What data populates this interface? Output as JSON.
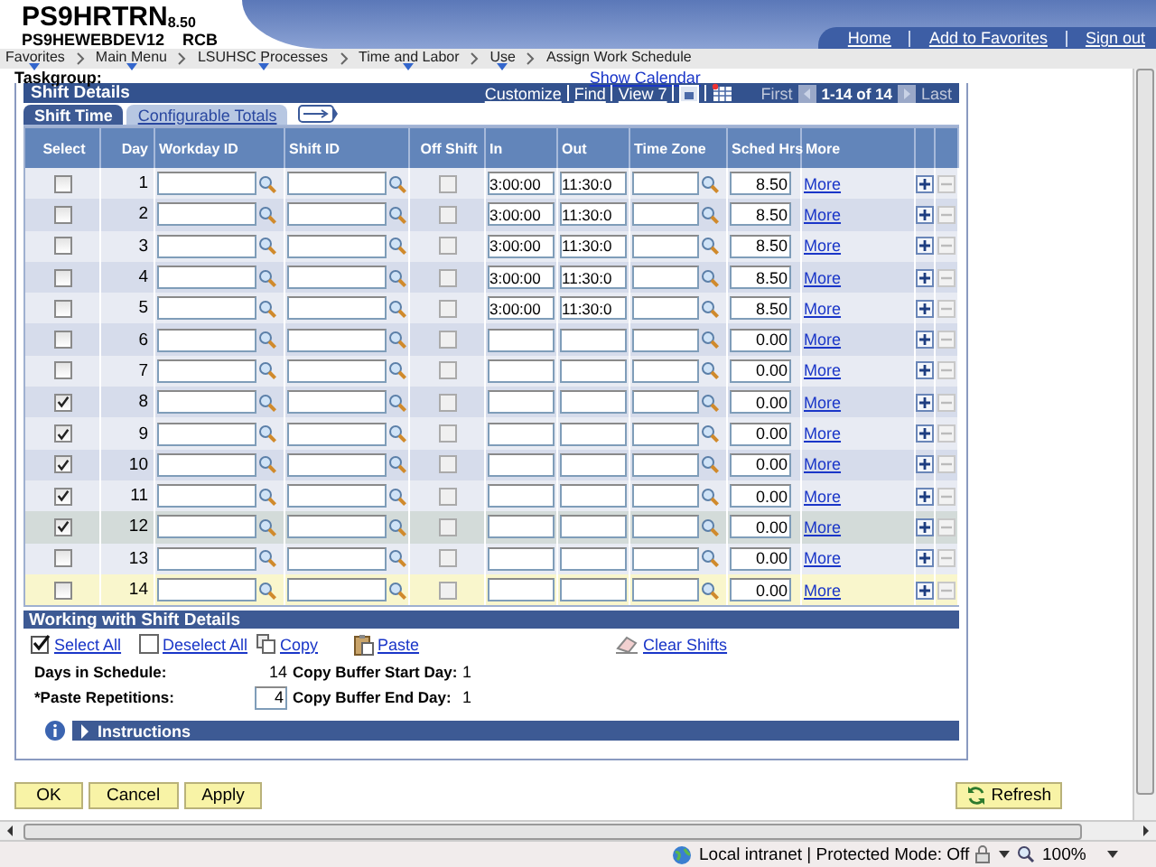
{
  "header": {
    "system": "PS9HRTRN",
    "version": "8.50",
    "database": "PS9HEWEBDEV12",
    "user": "RCB",
    "links": [
      "Home",
      "Add to Favorites",
      "Sign out"
    ]
  },
  "nav": [
    {
      "label": "Favorites",
      "menu": true
    },
    {
      "label": "Main Menu",
      "menu": true
    },
    {
      "label": "LSUHSC Processes",
      "menu": true
    },
    {
      "label": "Time and Labor",
      "menu": true
    },
    {
      "label": "Use",
      "menu": true
    },
    {
      "label": "Assign Work Schedule",
      "menu": false
    }
  ],
  "taskgroup_label": "Taskgroup:",
  "calendar_link": "Show Calendar",
  "shift_details": {
    "title": "Shift Details",
    "toolbar_links": [
      "Customize",
      "Find",
      "View 7"
    ],
    "pager": {
      "first": "First",
      "range": "1-14 of 14",
      "last": "Last"
    },
    "tabs": [
      {
        "label": "Shift Time",
        "selected": true
      },
      {
        "label": "Configurable Totals",
        "selected": false
      }
    ],
    "columns": [
      "Select",
      "Day",
      "Workday ID",
      "Shift ID",
      "Off Shift",
      "In",
      "Out",
      "Time Zone",
      "Sched Hrs",
      "More"
    ],
    "rows": [
      {
        "day": "1",
        "checked": false,
        "in": "3:00:00",
        "out": "11:30:0",
        "hours": "8.50",
        "more": "More",
        "selected": false,
        "hovered": false
      },
      {
        "day": "2",
        "checked": false,
        "in": "3:00:00",
        "out": "11:30:0",
        "hours": "8.50",
        "more": "More",
        "selected": false,
        "hovered": false
      },
      {
        "day": "3",
        "checked": false,
        "in": "3:00:00",
        "out": "11:30:0",
        "hours": "8.50",
        "more": "More",
        "selected": false,
        "hovered": false
      },
      {
        "day": "4",
        "checked": false,
        "in": "3:00:00",
        "out": "11:30:0",
        "hours": "8.50",
        "more": "More",
        "selected": false,
        "hovered": false
      },
      {
        "day": "5",
        "checked": false,
        "in": "3:00:00",
        "out": "11:30:0",
        "hours": "8.50",
        "more": "More",
        "selected": false,
        "hovered": false
      },
      {
        "day": "6",
        "checked": false,
        "hours": "0.00",
        "more": "More",
        "selected": false,
        "hovered": false
      },
      {
        "day": "7",
        "checked": false,
        "hours": "0.00",
        "more": "More",
        "selected": false,
        "hovered": false
      },
      {
        "day": "8",
        "checked": true,
        "hours": "0.00",
        "more": "More",
        "selected": false,
        "hovered": false
      },
      {
        "day": "9",
        "checked": true,
        "hours": "0.00",
        "more": "More",
        "selected": false,
        "hovered": false
      },
      {
        "day": "10",
        "checked": true,
        "hours": "0.00",
        "more": "More",
        "selected": false,
        "hovered": false
      },
      {
        "day": "11",
        "checked": true,
        "hours": "0.00",
        "more": "More",
        "selected": false,
        "hovered": false
      },
      {
        "day": "12",
        "checked": true,
        "hours": "0.00",
        "more": "More",
        "selected": false,
        "hovered": true
      },
      {
        "day": "13",
        "checked": false,
        "hours": "0.00",
        "more": "More",
        "selected": false,
        "hovered": false
      },
      {
        "day": "14",
        "checked": false,
        "hours": "0.00",
        "more": "More",
        "selected": true,
        "hovered": false
      }
    ]
  },
  "working": {
    "title": "Working with Shift Details",
    "actions": [
      {
        "label": "Select All",
        "kind": "select"
      },
      {
        "label": "Deselect All",
        "kind": "deselect"
      },
      {
        "label": "Copy",
        "kind": "copy"
      },
      {
        "label": "Paste",
        "kind": "paste"
      },
      {
        "label": "Clear Shifts",
        "kind": "clear"
      }
    ],
    "days_label": "Days in Schedule:",
    "days_value": "14",
    "paste_label": "*Paste Repetitions:",
    "paste_value": "4",
    "start_label": "Copy Buffer Start Day:",
    "start_value": "1",
    "end_label": "Copy Buffer End Day:",
    "end_value": "1",
    "instructions": "Instructions",
    "instructions_expanded": false
  },
  "buttons": [
    "OK",
    "Cancel",
    "Apply"
  ],
  "refresh": "Refresh",
  "status": {
    "zone": "Local intranet | Protected Mode: Off",
    "zoom": "100%"
  }
}
